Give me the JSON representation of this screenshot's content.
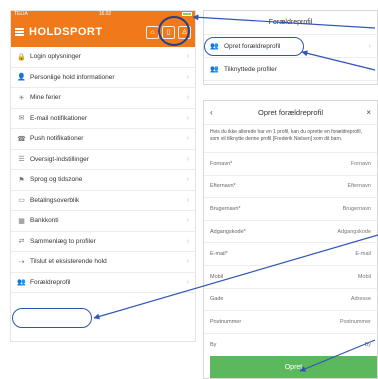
{
  "left": {
    "status": {
      "carrier": "TELIA",
      "time": "16.02"
    },
    "app_title": "HOLDSPORT",
    "menu": [
      {
        "icon": "lock-icon",
        "glyph": "🔒",
        "label": "Login oplysninger"
      },
      {
        "icon": "user-icon",
        "glyph": "👤",
        "label": "Personlige hold informationer"
      },
      {
        "icon": "sun-icon",
        "glyph": "☀",
        "label": "Mine ferier"
      },
      {
        "icon": "envelope-icon",
        "glyph": "✉",
        "label": "E-mail notifikationer"
      },
      {
        "icon": "push-icon",
        "glyph": "☎",
        "label": "Push notifikationer"
      },
      {
        "icon": "list-icon",
        "glyph": "☰",
        "label": "Oversigt-indstillinger"
      },
      {
        "icon": "flag-icon",
        "glyph": "⚑",
        "label": "Sprog og tidszone"
      },
      {
        "icon": "card-icon",
        "glyph": "▭",
        "label": "Betalingsoverblik"
      },
      {
        "icon": "bank-icon",
        "glyph": "▦",
        "label": "Bankkonti"
      },
      {
        "icon": "merge-icon",
        "glyph": "⇄",
        "label": "Sammenlæg to profiler"
      },
      {
        "icon": "arrow-right-icon",
        "glyph": "⇢",
        "label": "Tilslut et eksisterende hold"
      },
      {
        "icon": "users-icon",
        "glyph": "👥",
        "label": "Forældreprofil"
      }
    ]
  },
  "rtop": {
    "title": "Forældreprofil",
    "items": [
      {
        "icon": "users-icon",
        "glyph": "👥",
        "label": "Opret forældreprofil"
      },
      {
        "icon": "users-icon",
        "glyph": "👥",
        "label": "Tilknyttede profiler"
      }
    ]
  },
  "rform": {
    "back": "‹",
    "title": "Opret forældreprofil",
    "close": "×",
    "description": "Hvis du ikke allerede har en 1 profil, kan du oprette en forældreprofil, som vil tilknytte denne profil [Frederik Nielsen] som dit barn.",
    "fields": [
      {
        "label": "Fornavn*",
        "placeholder": "Fornavn"
      },
      {
        "label": "Efternavn*",
        "placeholder": "Efternavn"
      },
      {
        "label": "Brugernavn*",
        "placeholder": "Brugernavn"
      },
      {
        "label": "Adgangskode*",
        "placeholder": "Adgangskode"
      },
      {
        "label": "E-mail*",
        "placeholder": "E-mail"
      },
      {
        "label": "Mobil",
        "placeholder": "Mobil"
      },
      {
        "label": "Gade",
        "placeholder": "Adresse"
      },
      {
        "label": "Postnummer",
        "placeholder": "Postnummer"
      },
      {
        "label": "By",
        "placeholder": "By"
      }
    ],
    "submit": "Opret"
  },
  "colors": {
    "brand": "#f07a1a",
    "annotation": "#2f56b5",
    "submit": "#5cb85c"
  }
}
